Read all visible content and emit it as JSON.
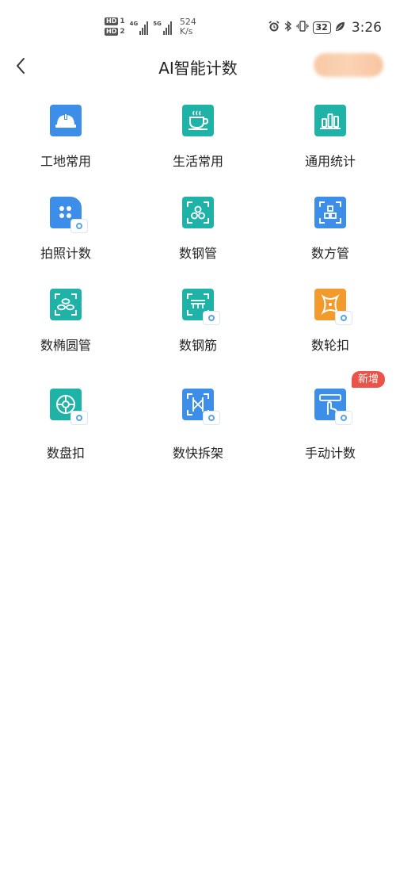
{
  "status_bar": {
    "hd1": "HD",
    "hd1_num": "1",
    "hd2": "HD",
    "hd2_num": "2",
    "net1": "4G",
    "net2": "5G",
    "speed_value": "524",
    "speed_unit": "K/s",
    "battery": "32",
    "time": "3:26"
  },
  "header": {
    "back_icon": "chevron-left-icon",
    "title": "AI智能计数"
  },
  "colors": {
    "blue": "#3d8ee8",
    "teal": "#1fb3a8",
    "orange": "#f39a2d",
    "badge": "#e9534a"
  },
  "grid": {
    "items": [
      {
        "label": "工地常用",
        "icon": "hard-hat-icon",
        "color": "#3d8ee8"
      },
      {
        "label": "生活常用",
        "icon": "coffee-cup-icon",
        "color": "#1fb3a8"
      },
      {
        "label": "通用统计",
        "icon": "bar-chart-icon",
        "color": "#1fb3a8"
      },
      {
        "label": "拍照计数",
        "icon": "photo-count-icon",
        "color": "#3d8ee8"
      },
      {
        "label": "数钢管",
        "icon": "steel-pipe-icon",
        "color": "#1fb3a8"
      },
      {
        "label": "数方管",
        "icon": "square-pipe-icon",
        "color": "#3d8ee8"
      },
      {
        "label": "数椭圆管",
        "icon": "oval-pipe-icon",
        "color": "#1fb3a8"
      },
      {
        "label": "数钢筋",
        "icon": "rebar-icon",
        "color": "#1fb3a8"
      },
      {
        "label": "数轮扣",
        "icon": "wheel-buckle-icon",
        "color": "#f39a2d"
      },
      {
        "label": "数盘扣",
        "icon": "disc-buckle-icon",
        "color": "#1fb3a8"
      },
      {
        "label": "数快拆架",
        "icon": "quick-release-frame-icon",
        "color": "#3d8ee8"
      },
      {
        "label": "手动计数",
        "icon": "manual-tap-icon",
        "color": "#3d8ee8"
      }
    ],
    "new_badge": "新增"
  }
}
